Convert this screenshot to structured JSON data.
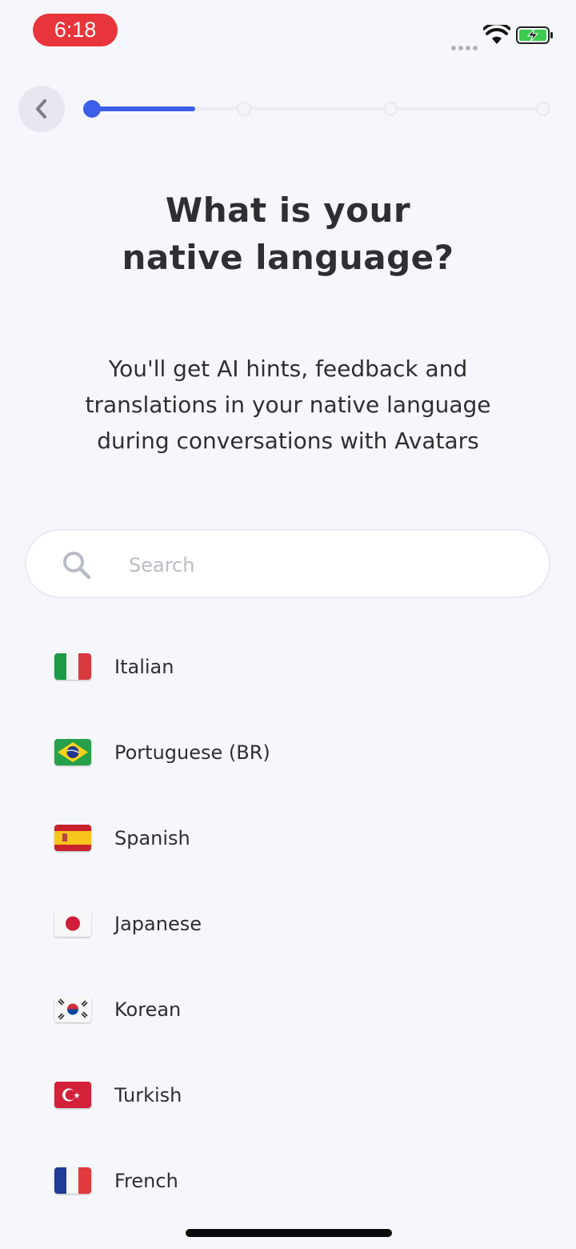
{
  "status_bar": {
    "time": "6:18"
  },
  "header": {
    "back_icon": "chevron-left-icon",
    "progress": {
      "steps": 4,
      "current_step": 1,
      "fill_fraction": 0.23
    }
  },
  "title": "What is your\nnative language?",
  "subtitle": "You'll get AI hints, feedback and\ntranslations in your native language\nduring conversations with Avatars",
  "search": {
    "placeholder": "Search",
    "value": ""
  },
  "languages": [
    {
      "label": "Italian",
      "flag": "italy-flag-icon"
    },
    {
      "label": "Portuguese (BR)",
      "flag": "brazil-flag-icon"
    },
    {
      "label": "Spanish",
      "flag": "spain-flag-icon"
    },
    {
      "label": "Japanese",
      "flag": "japan-flag-icon"
    },
    {
      "label": "Korean",
      "flag": "korea-flag-icon"
    },
    {
      "label": "Turkish",
      "flag": "turkey-flag-icon"
    },
    {
      "label": "French",
      "flag": "france-flag-icon"
    }
  ],
  "colors": {
    "accent": "#3d5ee8",
    "background": "#f6f7fc",
    "time_pill": "#e8353b"
  }
}
